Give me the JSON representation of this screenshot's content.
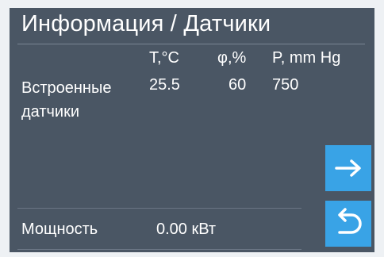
{
  "header": {
    "title": "Информация / Датчики"
  },
  "sensors": {
    "label": "Встроенные датчики",
    "columns": [
      "T,°C",
      "φ,%",
      "P, mm Hg"
    ],
    "values": [
      "25.5",
      "60",
      "750"
    ]
  },
  "power": {
    "label": "Мощность",
    "value": "0.00 кВт"
  },
  "buttons": {
    "next_icon": "arrow-right-icon",
    "back_icon": "return-icon"
  },
  "colors": {
    "background": "#4a5664",
    "accent": "#39a3e6",
    "text": "#ffffff"
  }
}
